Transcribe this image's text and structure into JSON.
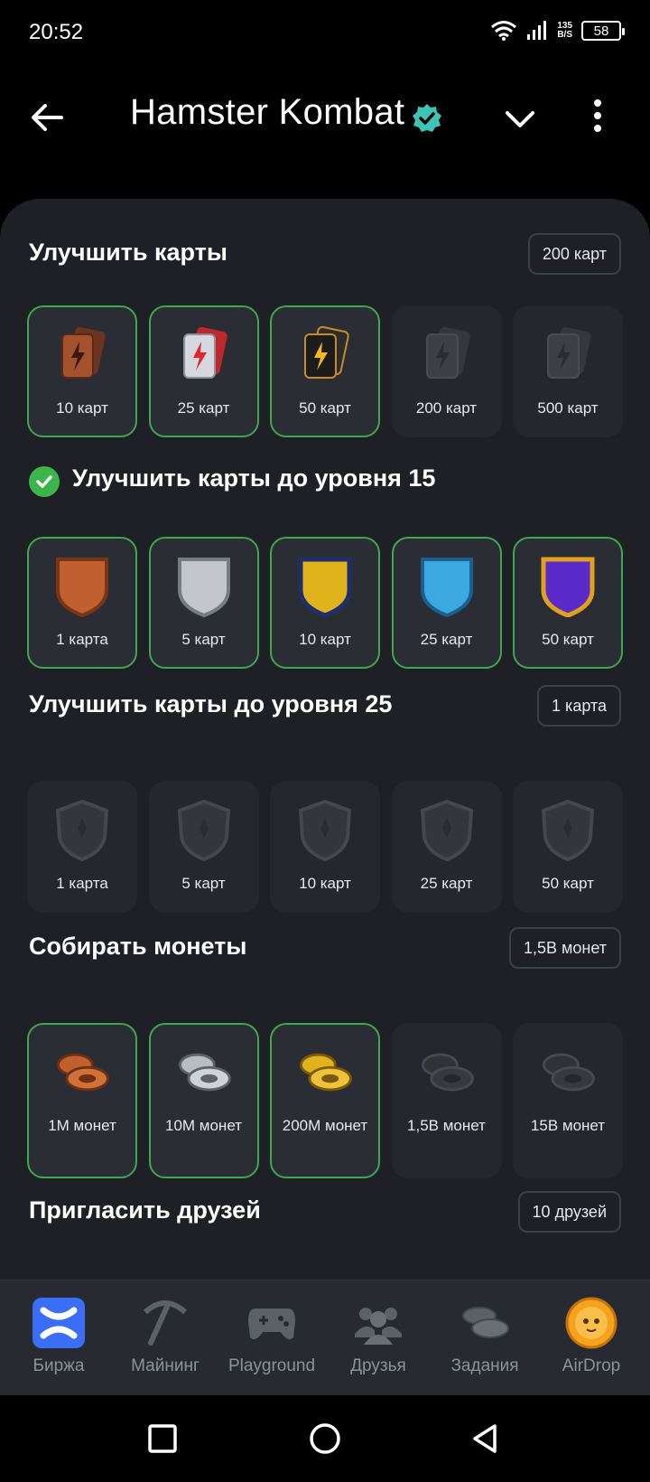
{
  "status": {
    "time": "20:52",
    "net_speed_value": "135",
    "net_speed_unit": "B/S",
    "battery": "58"
  },
  "header": {
    "title": "Hamster Kombat"
  },
  "sections": {
    "upgrade_cards": {
      "title": "Улучшить карты",
      "badge": "200 карт",
      "items": [
        {
          "label": "10 карт",
          "done": true,
          "tone": "#9a4a2c"
        },
        {
          "label": "25 карт",
          "done": true,
          "tone": "#b8bcc4"
        },
        {
          "label": "50 карт",
          "done": true,
          "tone": "#2a2a2a"
        },
        {
          "label": "200 карт",
          "done": false,
          "tone": "#3a3b3f"
        },
        {
          "label": "500 карт",
          "done": false,
          "tone": "#3a3b3f"
        }
      ]
    },
    "upgrade_lvl15": {
      "title": "Улучшить карты до уровня 15",
      "items": [
        {
          "label": "1 карта",
          "done": true,
          "tone": "#c0602e"
        },
        {
          "label": "5 карт",
          "done": true,
          "tone": "#c3c6cc"
        },
        {
          "label": "10 карт",
          "done": true,
          "tone": "#e0b21c"
        },
        {
          "label": "25 карт",
          "done": true,
          "tone": "#3ba8e0"
        },
        {
          "label": "50 карт",
          "done": true,
          "tone": "#5a2bc8"
        }
      ]
    },
    "upgrade_lvl25": {
      "title": "Улучшить карты до уровня 25",
      "badge": "1 карта",
      "items": [
        {
          "label": "1 карта",
          "done": false
        },
        {
          "label": "5 карт",
          "done": false
        },
        {
          "label": "10 карт",
          "done": false
        },
        {
          "label": "25 карт",
          "done": false
        },
        {
          "label": "50 карт",
          "done": false
        }
      ]
    },
    "collect_coins": {
      "title": "Собирать монеты",
      "badge": "1,5B монет",
      "items": [
        {
          "label": "1M монет",
          "done": true,
          "tone": "#c0602e"
        },
        {
          "label": "10M монет",
          "done": true,
          "tone": "#c3c6cc"
        },
        {
          "label": "200M монет",
          "done": true,
          "tone": "#e0b21c"
        },
        {
          "label": "1,5B монет",
          "done": false,
          "tone": "#3a3b3f"
        },
        {
          "label": "15B монет",
          "done": false,
          "tone": "#3a3b3f"
        }
      ]
    },
    "invite_friends": {
      "title": "Пригласить друзей",
      "badge": "10 друзей"
    }
  },
  "nav": [
    {
      "label": "Биржа",
      "icon": "exchange-icon",
      "active": true
    },
    {
      "label": "Майнинг",
      "icon": "pickaxe-icon",
      "active": false
    },
    {
      "label": "Playground",
      "icon": "gamepad-icon",
      "active": false
    },
    {
      "label": "Друзья",
      "icon": "friends-icon",
      "active": false
    },
    {
      "label": "Задания",
      "icon": "coins-icon",
      "active": false
    },
    {
      "label": "AirDrop",
      "icon": "hamster-coin-icon",
      "active": false
    }
  ],
  "colors": {
    "accent_green": "#3ea84f",
    "verified": "#3fc3b4",
    "active_nav": "#3b6ef7"
  }
}
